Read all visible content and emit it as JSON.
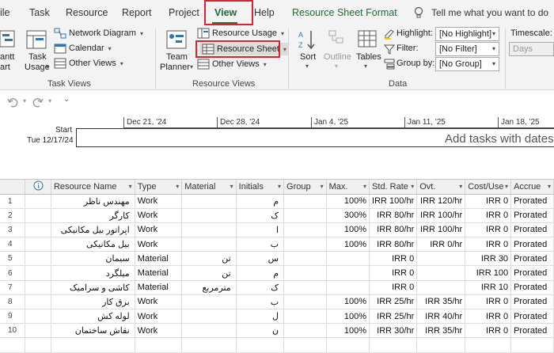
{
  "tabs": [
    "ile",
    "Task",
    "Resource",
    "Report",
    "Project",
    "View",
    "Help",
    "Resource Sheet Format"
  ],
  "tell_me": "Tell me what you want to do",
  "ribbon": {
    "gantt_top": "antt",
    "gantt_bottom": "art",
    "task_usage_top": "Task",
    "task_usage_bottom": "Usage",
    "network_diagram": "Network Diagram",
    "calendar": "Calendar",
    "other_views_task": "Other Views",
    "task_views_label": "Task Views",
    "team_planner_top": "Team",
    "team_planner_bottom": "Planner",
    "resource_usage": "Resource Usage",
    "resource_sheet": "Resource Sheet",
    "other_views_resource": "Other Views",
    "resource_views_label": "Resource Views",
    "sort": "Sort",
    "outline": "Outline",
    "tables": "Tables",
    "highlight_label": "Highlight:",
    "highlight_value": "[No Highlight]",
    "filter_label": "Filter:",
    "filter_value": "[No Filter]",
    "groupby_label": "Group by:",
    "groupby_value": "[No Group]",
    "data_label": "Data",
    "timescale_label": "Timescale:",
    "timescale_value": "Days"
  },
  "timeline": {
    "dates": [
      "Dec 21, '24",
      "Dec 28, '24",
      "Jan 4, '25",
      "Jan 11, '25",
      "Jan 18, '25"
    ],
    "start_label": "Start",
    "start_date": "Tue 12/17/24",
    "placeholder": "Add tasks with dates to"
  },
  "grid": {
    "info_icon": "info-icon",
    "columns": [
      "Resource Name",
      "Type",
      "Material",
      "Initials",
      "Group",
      "Max.",
      "Std. Rate",
      "Ovt.",
      "Cost/Use",
      "Accrue"
    ],
    "rows": [
      {
        "n": "1",
        "name": "مهندس ناظر",
        "type": "Work",
        "material": "",
        "initials": "م",
        "group": "",
        "max": "100%",
        "std": "IRR 100/hr",
        "ovt": "IRR 120/hr",
        "cost": "IRR 0",
        "accrue": "Prorated"
      },
      {
        "n": "2",
        "name": "کارگر",
        "type": "Work",
        "material": "",
        "initials": "ک",
        "group": "",
        "max": "300%",
        "std": "IRR 80/hr",
        "ovt": "IRR 100/hr",
        "cost": "IRR 0",
        "accrue": "Prorated"
      },
      {
        "n": "3",
        "name": "اپراتور بیل مکانیکی",
        "type": "Work",
        "material": "",
        "initials": "ا",
        "group": "",
        "max": "100%",
        "std": "IRR 80/hr",
        "ovt": "IRR 100/hr",
        "cost": "IRR 0",
        "accrue": "Prorated"
      },
      {
        "n": "4",
        "name": "بیل مکانیکی",
        "type": "Work",
        "material": "",
        "initials": "ب",
        "group": "",
        "max": "100%",
        "std": "IRR 80/hr",
        "ovt": "IRR 0/hr",
        "cost": "IRR 0",
        "accrue": "Prorated"
      },
      {
        "n": "5",
        "name": "سیمان",
        "type": "Material",
        "material": "تن",
        "initials": "س",
        "group": "",
        "max": "",
        "std": "IRR 0",
        "ovt": "",
        "cost": "IRR 30",
        "accrue": "Prorated"
      },
      {
        "n": "6",
        "name": "میلگرد",
        "type": "Material",
        "material": "تن",
        "initials": "م",
        "group": "",
        "max": "",
        "std": "IRR 0",
        "ovt": "",
        "cost": "IRR 100",
        "accrue": "Prorated"
      },
      {
        "n": "7",
        "name": "کاشی و سرامیک",
        "type": "Material",
        "material": "مترمربع",
        "initials": "ک",
        "group": "",
        "max": "",
        "std": "IRR 0",
        "ovt": "",
        "cost": "IRR 10",
        "accrue": "Prorated"
      },
      {
        "n": "8",
        "name": "برق کار",
        "type": "Work",
        "material": "",
        "initials": "ب",
        "group": "",
        "max": "100%",
        "std": "IRR 25/hr",
        "ovt": "IRR 35/hr",
        "cost": "IRR 0",
        "accrue": "Prorated"
      },
      {
        "n": "9",
        "name": "لوله کش",
        "type": "Work",
        "material": "",
        "initials": "ل",
        "group": "",
        "max": "100%",
        "std": "IRR 25/hr",
        "ovt": "IRR 40/hr",
        "cost": "IRR 0",
        "accrue": "Prorated"
      },
      {
        "n": "10",
        "name": "نقاش ساختمان",
        "type": "Work",
        "material": "",
        "initials": "ن",
        "group": "",
        "max": "100%",
        "std": "IRR 30/hr",
        "ovt": "IRR 35/hr",
        "cost": "IRR 0",
        "accrue": "Prorated"
      }
    ]
  },
  "colors": {
    "accent": "#217346",
    "highlight_box": "#d9232d",
    "tab_bg": "#f3f3f3"
  }
}
